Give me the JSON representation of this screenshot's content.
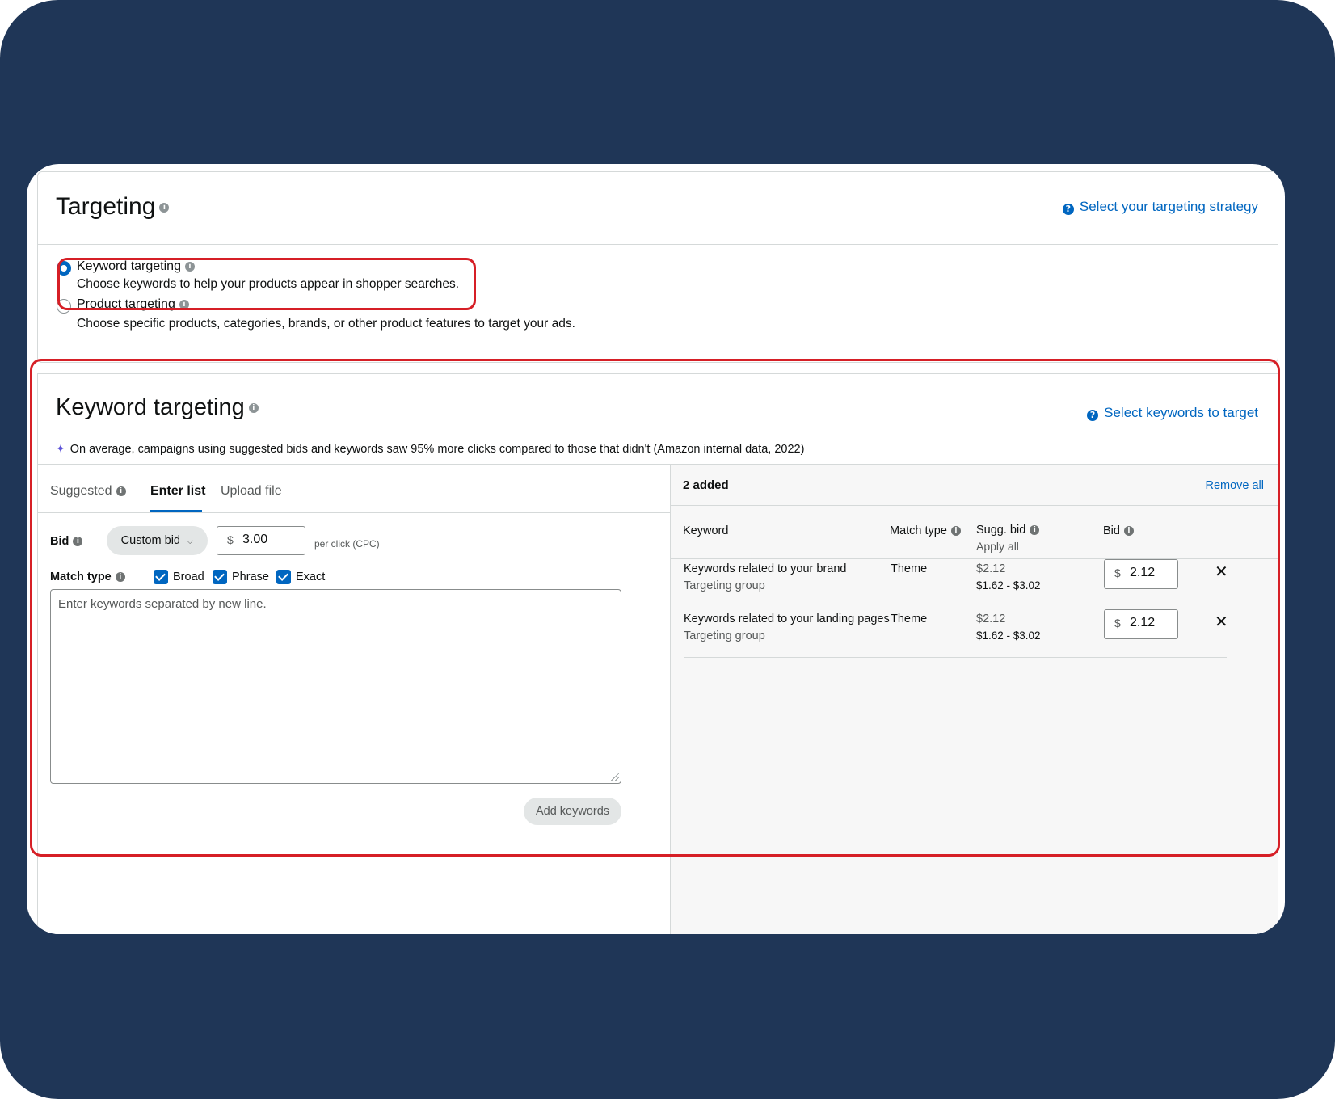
{
  "targeting": {
    "title": "Targeting",
    "help_link": "Select your targeting strategy",
    "options": [
      {
        "label": "Keyword targeting",
        "description": "Choose keywords to help your products appear in shopper searches.",
        "selected": true
      },
      {
        "label": "Product targeting",
        "description": "Choose specific products, categories, brands, or other product features to target your ads.",
        "selected": false
      }
    ]
  },
  "keyword_targeting": {
    "title": "Keyword targeting",
    "help_link": "Select keywords to target",
    "note": "On average, campaigns using suggested bids and keywords saw 95% more clicks compared to those that didn't (Amazon internal data, 2022)",
    "tabs": [
      "Suggested",
      "Enter list",
      "Upload file"
    ],
    "active_tab": "Enter list",
    "bid": {
      "label": "Bid",
      "mode": "Custom bid",
      "currency": "$",
      "value": "3.00",
      "unit": "per click (CPC)"
    },
    "match_type": {
      "label": "Match type",
      "options": [
        {
          "label": "Broad",
          "checked": true
        },
        {
          "label": "Phrase",
          "checked": true
        },
        {
          "label": "Exact",
          "checked": true
        }
      ]
    },
    "keywords_placeholder": "Enter keywords separated by new line.",
    "add_button": "Add keywords"
  },
  "added": {
    "count_label": "2 added",
    "remove_all": "Remove all",
    "columns": {
      "keyword": "Keyword",
      "match_type": "Match type",
      "sugg_bid": "Sugg. bid",
      "apply_all": "Apply all",
      "bid": "Bid"
    },
    "rows": [
      {
        "keyword": "Keywords related to your brand",
        "group": "Targeting group",
        "match": "Theme",
        "sugg": "$2.12",
        "range": "$1.62 - $3.02",
        "currency": "$",
        "bid": "2.12"
      },
      {
        "keyword": "Keywords related to your landing pages",
        "group": "Targeting group",
        "match": "Theme",
        "sugg": "$2.12",
        "range": "$1.62 - $3.02",
        "currency": "$",
        "bid": "2.12"
      }
    ]
  },
  "colors": {
    "background": "#1f3657",
    "accent": "#0066c0",
    "highlight": "#d61f26"
  }
}
